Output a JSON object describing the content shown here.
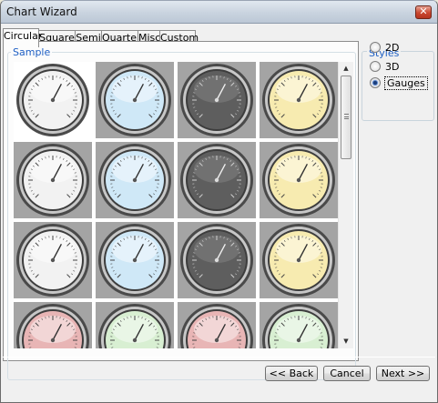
{
  "window": {
    "title": "Chart Wizard"
  },
  "tabs": [
    "Circular",
    "Square",
    "Semi",
    "Quarter",
    "Misc",
    "Custom"
  ],
  "sample": {
    "label": "Sample"
  },
  "styles": {
    "label": "Styles",
    "options": [
      "2D",
      "3D",
      "Gauges"
    ],
    "selected": "Gauges"
  },
  "gallery": {
    "rows": [
      [
        "white",
        "blue",
        "dark",
        "yellow"
      ],
      [
        "white",
        "blue",
        "dark",
        "yellow"
      ],
      [
        "white",
        "blue",
        "dark",
        "yellow"
      ],
      [
        "red",
        "green",
        "red",
        "green"
      ]
    ],
    "selected_index": 0
  },
  "colors": {
    "face_white": "#f2f2f2",
    "face_blue": "#cfe8f7",
    "face_dark": "#5e5e5e",
    "face_yellow": "#f7ebb0",
    "face_red": "#e8b5b5",
    "face_green": "#d8efd2",
    "accent": "#1e5fc4"
  },
  "buttons": {
    "back": "<< Back",
    "cancel": "Cancel",
    "next": "Next >>"
  }
}
